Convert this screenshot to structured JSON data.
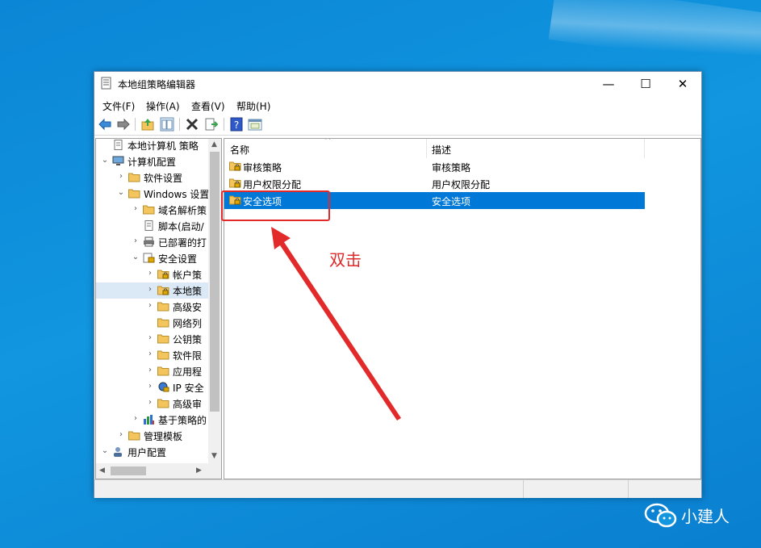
{
  "window": {
    "title": "本地组策略编辑器"
  },
  "title_buttons": {
    "minimize": "—",
    "maximize": "☐",
    "close": "✕"
  },
  "menu": [
    "文件(F)",
    "操作(A)",
    "查看(V)",
    "帮助(H)"
  ],
  "tree": [
    {
      "label": "本地计算机 策略",
      "expander": "",
      "icon": "policy-icon"
    },
    {
      "label": "计算机配置",
      "expander": "⌄",
      "icon": "computer-icon"
    },
    {
      "label": "软件设置",
      "expander": "›",
      "icon": "folder-icon"
    },
    {
      "label": "Windows 设置",
      "expander": "⌄",
      "icon": "folder-icon"
    },
    {
      "label": "域名解析策",
      "expander": "›",
      "icon": "folder-icon"
    },
    {
      "label": "脚本(启动/",
      "expander": "",
      "icon": "script-icon"
    },
    {
      "label": "已部署的打",
      "expander": "›",
      "icon": "printer-icon"
    },
    {
      "label": "安全设置",
      "expander": "⌄",
      "icon": "security-icon"
    },
    {
      "label": "帐户策",
      "expander": "›",
      "icon": "lock-folder-icon"
    },
    {
      "label": "本地策",
      "expander": "›",
      "icon": "lock-folder-icon"
    },
    {
      "label": "高级安",
      "expander": "›",
      "icon": "folder-icon"
    },
    {
      "label": "网络列",
      "expander": "",
      "icon": "folder-icon"
    },
    {
      "label": "公钥策",
      "expander": "›",
      "icon": "folder-icon"
    },
    {
      "label": "软件限",
      "expander": "›",
      "icon": "folder-icon"
    },
    {
      "label": "应用程",
      "expander": "›",
      "icon": "folder-icon"
    },
    {
      "label": "IP 安全",
      "expander": "›",
      "icon": "ip-security-icon"
    },
    {
      "label": "高级审",
      "expander": "›",
      "icon": "folder-icon"
    },
    {
      "label": "基于策略的",
      "expander": "›",
      "icon": "chart-icon"
    },
    {
      "label": "管理模板",
      "expander": "›",
      "icon": "folder-icon"
    },
    {
      "label": "用户配置",
      "expander": "⌄",
      "icon": "user-icon"
    }
  ],
  "list": {
    "columns": [
      "名称",
      "描述"
    ],
    "sort_indicator": "^",
    "rows": [
      {
        "name": "审核策略",
        "desc": "审核策略",
        "icon": "lock-folder-icon"
      },
      {
        "name": "用户权限分配",
        "desc": "用户权限分配",
        "icon": "lock-folder-icon"
      },
      {
        "name": "安全选项",
        "desc": "安全选项",
        "icon": "lock-folder-icon",
        "selected": true
      }
    ]
  },
  "annotation": {
    "text": "双击",
    "color": "#e22a2a"
  },
  "watermark": {
    "text": "小建人"
  },
  "colors": {
    "selection": "#0078d7",
    "tree_selection": "#dbe8f5",
    "folder": "#f5c55d",
    "annotation": "#e22a2a"
  }
}
